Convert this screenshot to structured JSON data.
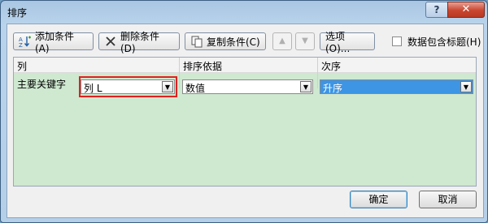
{
  "window": {
    "title": "排序"
  },
  "titlebar": {
    "help_label": "?",
    "close_label": "✕"
  },
  "toolbar": {
    "add_label": "添加条件(A)",
    "delete_label": "删除条件(D)",
    "copy_label": "复制条件(C)",
    "options_label": "选项(O)...",
    "header_checkbox_label": "数据包含标题(H)",
    "header_checkbox_checked": false
  },
  "grid": {
    "columns": [
      "列",
      "排序依据",
      "次序"
    ],
    "rows": [
      {
        "label": "主要关键字",
        "column": "列 L",
        "sort_on": "数值",
        "order": "升序"
      }
    ]
  },
  "footer": {
    "ok_label": "确定",
    "cancel_label": "取消"
  },
  "colors": {
    "grid_bg": "#cfe8d0",
    "selection": "#3d95e4",
    "highlight_box": "#e02020"
  }
}
